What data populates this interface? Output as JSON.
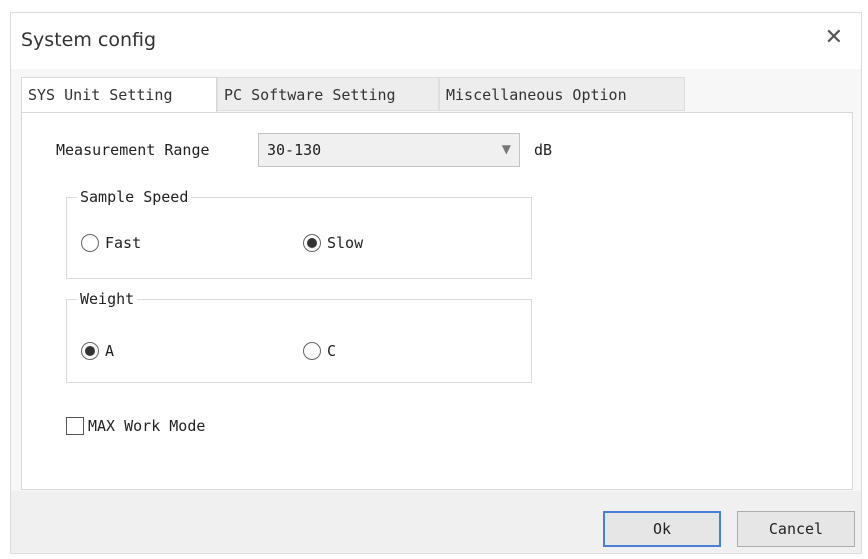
{
  "dialog": {
    "title": "System config"
  },
  "tabs": [
    {
      "label": "SYS Unit Setting",
      "active": true
    },
    {
      "label": "PC Software Setting",
      "active": false
    },
    {
      "label": "Miscellaneous Option",
      "active": false
    }
  ],
  "settings": {
    "measurement_range_label": "Measurement Range",
    "measurement_range_value": "30-130",
    "measurement_range_unit": "dB",
    "sample_speed": {
      "title": "Sample Speed",
      "options": [
        "Fast",
        "Slow"
      ],
      "selected": "Slow"
    },
    "weight": {
      "title": "Weight",
      "options": [
        "A",
        "C"
      ],
      "selected": "A"
    },
    "max_work_mode": {
      "label": "MAX Work Mode",
      "checked": false
    }
  },
  "buttons": {
    "ok": "Ok",
    "cancel": "Cancel"
  }
}
